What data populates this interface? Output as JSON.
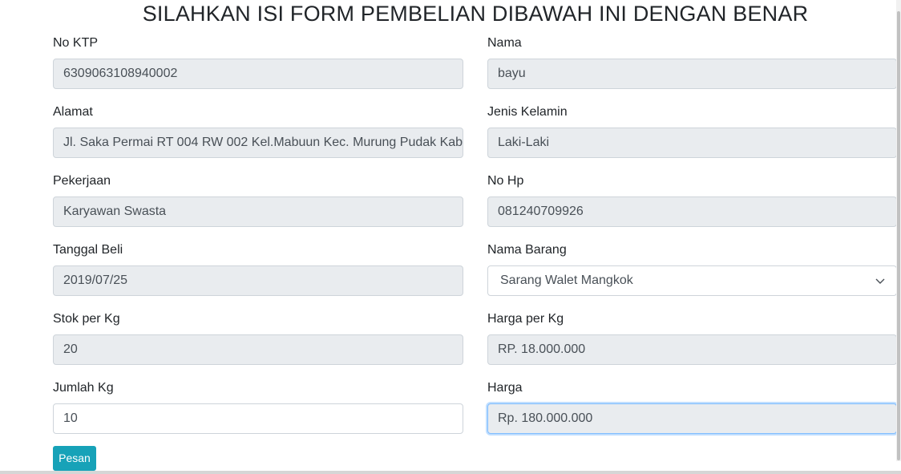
{
  "title": "SILAHKAN ISI FORM PEMBELIAN DIBAWAH INI DENGAN BENAR",
  "form": {
    "no_ktp": {
      "label": "No KTP",
      "value": "6309063108940002"
    },
    "nama": {
      "label": "Nama",
      "value": "bayu"
    },
    "alamat": {
      "label": "Alamat",
      "value": "Jl. Saka Permai RT 004 RW 002 Kel.Mabuun Kec. Murung Pudak Kab."
    },
    "jenis_kelamin": {
      "label": "Jenis Kelamin",
      "value": "Laki-Laki"
    },
    "pekerjaan": {
      "label": "Pekerjaan",
      "value": "Karyawan Swasta"
    },
    "no_hp": {
      "label": "No Hp",
      "value": "081240709926"
    },
    "tanggal_beli": {
      "label": "Tanggal Beli",
      "value": "2019/07/25"
    },
    "nama_barang": {
      "label": "Nama Barang",
      "value": "Sarang Walet Mangkok"
    },
    "stok": {
      "label": "Stok per Kg",
      "value": "20"
    },
    "harga_per_kg": {
      "label": "Harga per Kg",
      "value": "RP. 18.000.000"
    },
    "jumlah_kg": {
      "label": "Jumlah Kg",
      "value": "10"
    },
    "harga": {
      "label": "Harga",
      "value": "Rp. 180.000.000"
    }
  },
  "submit_label": "Pesan",
  "icons": {
    "select": "chevron-down-icon"
  },
  "colors": {
    "button": "#17a2b8",
    "readonly_bg": "#e9ecef",
    "focus_border": "#80bdff"
  }
}
